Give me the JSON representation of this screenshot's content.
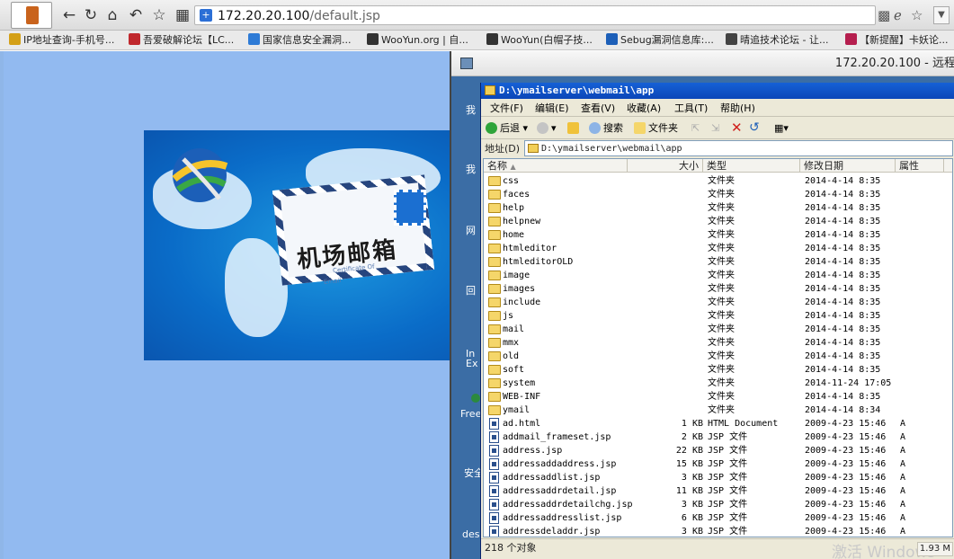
{
  "browser": {
    "url_host": "172.20.20.100",
    "url_path": "/default.jsp"
  },
  "bookmarks": [
    {
      "label": "IP地址查询-手机号...",
      "color": "#d4a017"
    },
    {
      "label": "吾爱破解论坛【LC...",
      "color": "#c0282d"
    },
    {
      "label": "国家信息安全漏洞...",
      "color": "#2e7bd6"
    },
    {
      "label": "WooYun.org | 自...",
      "color": "#333333"
    },
    {
      "label": "WooYun(白帽子技...",
      "color": "#333333"
    },
    {
      "label": "Sebug漏洞信息库:...",
      "color": "#1d5fb8"
    },
    {
      "label": "晴追技术论坛 - 让...",
      "color": "#444444"
    },
    {
      "label": "【新提醒】卡妖论...",
      "color": "#b51e4e"
    }
  ],
  "banner": {
    "title": "机场邮箱",
    "sub1": "Certificate Of",
    "sub2": "Email"
  },
  "remote": {
    "title": "172.20.20.100 - 远程"
  },
  "desktop_labels": [
    "我",
    "我",
    "网",
    "回",
    "In",
    "Ex",
    "Free",
    "安全",
    "desk"
  ],
  "explorer": {
    "title": "D:\\ymailserver\\webmail\\app",
    "menus": [
      "文件(F)",
      "编辑(E)",
      "查看(V)",
      "收藏(A)",
      "工具(T)",
      "帮助(H)"
    ],
    "toolbar": {
      "back": "后退",
      "search": "搜索",
      "folders": "文件夹"
    },
    "address_label": "地址(D)",
    "address_value": "D:\\ymailserver\\webmail\\app",
    "columns": {
      "name": "名称",
      "size": "大小",
      "type": "类型",
      "modified": "修改日期",
      "attr": "属性"
    },
    "rows": [
      {
        "kind": "folder",
        "name": "css",
        "size": "",
        "type": "文件夹",
        "modified": "2014-4-14 8:35",
        "attr": ""
      },
      {
        "kind": "folder",
        "name": "faces",
        "size": "",
        "type": "文件夹",
        "modified": "2014-4-14 8:35",
        "attr": ""
      },
      {
        "kind": "folder",
        "name": "help",
        "size": "",
        "type": "文件夹",
        "modified": "2014-4-14 8:35",
        "attr": ""
      },
      {
        "kind": "folder",
        "name": "helpnew",
        "size": "",
        "type": "文件夹",
        "modified": "2014-4-14 8:35",
        "attr": ""
      },
      {
        "kind": "folder",
        "name": "home",
        "size": "",
        "type": "文件夹",
        "modified": "2014-4-14 8:35",
        "attr": ""
      },
      {
        "kind": "folder",
        "name": "htmleditor",
        "size": "",
        "type": "文件夹",
        "modified": "2014-4-14 8:35",
        "attr": ""
      },
      {
        "kind": "folder",
        "name": "htmleditorOLD",
        "size": "",
        "type": "文件夹",
        "modified": "2014-4-14 8:35",
        "attr": ""
      },
      {
        "kind": "folder",
        "name": "image",
        "size": "",
        "type": "文件夹",
        "modified": "2014-4-14 8:35",
        "attr": ""
      },
      {
        "kind": "folder",
        "name": "images",
        "size": "",
        "type": "文件夹",
        "modified": "2014-4-14 8:35",
        "attr": ""
      },
      {
        "kind": "folder",
        "name": "include",
        "size": "",
        "type": "文件夹",
        "modified": "2014-4-14 8:35",
        "attr": ""
      },
      {
        "kind": "folder",
        "name": "js",
        "size": "",
        "type": "文件夹",
        "modified": "2014-4-14 8:35",
        "attr": ""
      },
      {
        "kind": "folder",
        "name": "mail",
        "size": "",
        "type": "文件夹",
        "modified": "2014-4-14 8:35",
        "attr": ""
      },
      {
        "kind": "folder",
        "name": "mmx",
        "size": "",
        "type": "文件夹",
        "modified": "2014-4-14 8:35",
        "attr": ""
      },
      {
        "kind": "folder",
        "name": "old",
        "size": "",
        "type": "文件夹",
        "modified": "2014-4-14 8:35",
        "attr": ""
      },
      {
        "kind": "folder",
        "name": "soft",
        "size": "",
        "type": "文件夹",
        "modified": "2014-4-14 8:35",
        "attr": ""
      },
      {
        "kind": "folder",
        "name": "system",
        "size": "",
        "type": "文件夹",
        "modified": "2014-11-24 17:05",
        "attr": ""
      },
      {
        "kind": "folder",
        "name": "WEB-INF",
        "size": "",
        "type": "文件夹",
        "modified": "2014-4-14 8:35",
        "attr": ""
      },
      {
        "kind": "folder",
        "name": "ymail",
        "size": "",
        "type": "文件夹",
        "modified": "2014-4-14 8:34",
        "attr": ""
      },
      {
        "kind": "file",
        "name": "ad.html",
        "size": "1 KB",
        "type": "HTML Document",
        "modified": "2009-4-23 15:46",
        "attr": "A"
      },
      {
        "kind": "file",
        "name": "addmail_frameset.jsp",
        "size": "2 KB",
        "type": "JSP 文件",
        "modified": "2009-4-23 15:46",
        "attr": "A"
      },
      {
        "kind": "file",
        "name": "address.jsp",
        "size": "22 KB",
        "type": "JSP 文件",
        "modified": "2009-4-23 15:46",
        "attr": "A"
      },
      {
        "kind": "file",
        "name": "addressaddaddress.jsp",
        "size": "15 KB",
        "type": "JSP 文件",
        "modified": "2009-4-23 15:46",
        "attr": "A"
      },
      {
        "kind": "file",
        "name": "addressaddlist.jsp",
        "size": "3 KB",
        "type": "JSP 文件",
        "modified": "2009-4-23 15:46",
        "attr": "A"
      },
      {
        "kind": "file",
        "name": "addressaddrdetail.jsp",
        "size": "11 KB",
        "type": "JSP 文件",
        "modified": "2009-4-23 15:46",
        "attr": "A"
      },
      {
        "kind": "file",
        "name": "addressaddrdetailchg.jsp",
        "size": "3 KB",
        "type": "JSP 文件",
        "modified": "2009-4-23 15:46",
        "attr": "A"
      },
      {
        "kind": "file",
        "name": "addressaddresslist.jsp",
        "size": "6 KB",
        "type": "JSP 文件",
        "modified": "2009-4-23 15:46",
        "attr": "A"
      },
      {
        "kind": "file",
        "name": "addressdeladdr.jsp",
        "size": "3 KB",
        "type": "JSP 文件",
        "modified": "2009-4-23 15:46",
        "attr": "A"
      }
    ],
    "status": "218 个对象",
    "status_right": "1.93 M",
    "watermark": "激活 Windows"
  }
}
